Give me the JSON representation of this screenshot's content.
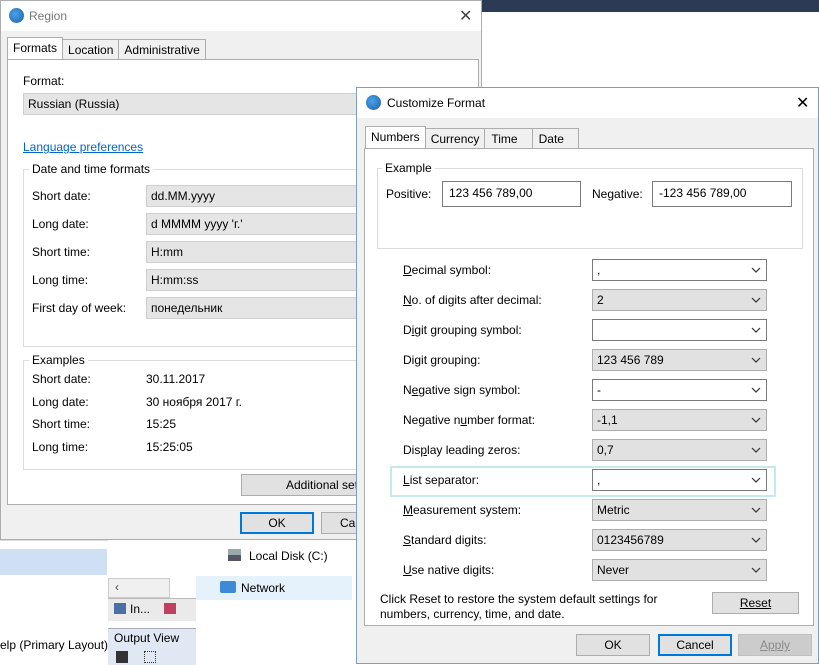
{
  "region": {
    "title": "Region",
    "tabs": [
      "Formats",
      "Location",
      "Administrative"
    ],
    "format_label": "Format:",
    "format_value": "Russian (Russia)",
    "language_link": "Language preferences",
    "datetime_group": "Date and time formats",
    "rows": [
      {
        "label": "Short date:",
        "value": "dd.MM.yyyy"
      },
      {
        "label": "Long date:",
        "value": "d MMMM yyyy 'г.'"
      },
      {
        "label": "Short time:",
        "value": "H:mm"
      },
      {
        "label": "Long time:",
        "value": "H:mm:ss"
      },
      {
        "label": "First day of week:",
        "value": "понедельник"
      }
    ],
    "examples_group": "Examples",
    "examples": [
      {
        "label": "Short date:",
        "value": "30.11.2017"
      },
      {
        "label": "Long date:",
        "value": "30 ноября 2017 г."
      },
      {
        "label": "Short time:",
        "value": "15:25"
      },
      {
        "label": "Long time:",
        "value": "15:25:05"
      }
    ],
    "additional_button": "Additional set",
    "ok": "OK",
    "cancel": "Ca"
  },
  "background": {
    "explorer_local_disk": "Local Disk (C:)",
    "explorer_network": "Network",
    "left_help": "elp (Primary Layout)",
    "tab_in": "In...",
    "output_view": "Output View"
  },
  "customize": {
    "title": "Customize Format",
    "tabs": [
      "Numbers",
      "Currency",
      "Time",
      "Date"
    ],
    "example_group": "Example",
    "positive_label": "Positive:",
    "positive_value": "123 456 789,00",
    "negative_label": "Negative:",
    "negative_value": "-123 456 789,00",
    "settings": [
      {
        "label": "Decimal symbol:",
        "u": "D",
        "rest": "ecimal symbol:",
        "value": ",",
        "style": "white"
      },
      {
        "label": "No. of digits after decimal:",
        "u": "N",
        "rest": "o. of digits after decimal:",
        "value": "2",
        "style": "gray"
      },
      {
        "label": "Digit grouping symbol:",
        "u": "i",
        "pre": "D",
        "rest": "git grouping symbol:",
        "value": "",
        "style": "white"
      },
      {
        "label": "Digit grouping:",
        "u": "g",
        "pre": "Di",
        "rest": "it grouping:",
        "value": "123 456 789",
        "style": "gray"
      },
      {
        "label": "Negative sign symbol:",
        "u": "e",
        "pre": "N",
        "rest": "gative sign symbol:",
        "value": "-",
        "style": "white"
      },
      {
        "label": "Negative number format:",
        "u": "u",
        "pre": "Negative n",
        "rest": "mber format:",
        "value": "-1,1",
        "style": "gray"
      },
      {
        "label": "Display leading zeros:",
        "u": "p",
        "pre": "Dis",
        "rest": "lay leading zeros:",
        "value": "0,7",
        "style": "gray"
      },
      {
        "label": "List separator:",
        "u": "L",
        "pre": "",
        "rest": "ist separator:",
        "value": ",",
        "style": "white"
      },
      {
        "label": "Measurement system:",
        "u": "M",
        "pre": "",
        "rest": "easurement system:",
        "value": "Metric",
        "style": "gray"
      },
      {
        "label": "Standard digits:",
        "u": "S",
        "pre": "",
        "rest": "tandard digits:",
        "value": "0123456789",
        "style": "gray"
      },
      {
        "label": "Use native digits:",
        "u": "U",
        "pre": "",
        "rest": "se native digits:",
        "value": "Never",
        "style": "gray"
      }
    ],
    "reset_text_1": "Click Reset to restore the system default settings for",
    "reset_text_2": "numbers, currency, time, and date.",
    "reset_button": "Reset",
    "ok": "OK",
    "cancel": "Cancel",
    "apply": "Apply"
  }
}
